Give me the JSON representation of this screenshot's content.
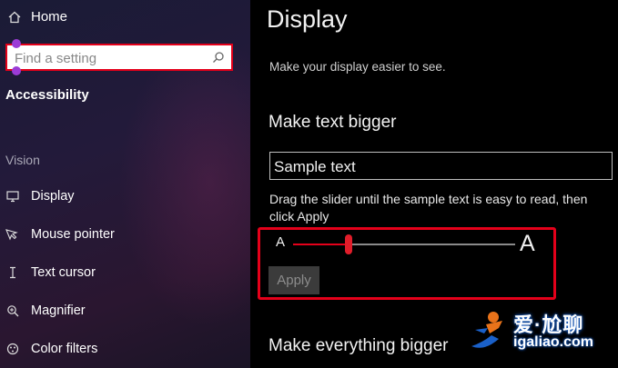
{
  "sidebar": {
    "home_label": "Home",
    "search_placeholder": "Find a setting",
    "section_title": "Accessibility",
    "group_label": "Vision",
    "items": [
      {
        "label": "Display",
        "icon": "monitor-icon"
      },
      {
        "label": "Mouse pointer",
        "icon": "mouse-pointer-icon"
      },
      {
        "label": "Text cursor",
        "icon": "text-cursor-icon"
      },
      {
        "label": "Magnifier",
        "icon": "magnifier-icon"
      },
      {
        "label": "Color filters",
        "icon": "color-filters-icon"
      }
    ]
  },
  "main": {
    "title": "Display",
    "subtitle": "Make your display easier to see.",
    "section_text_bigger": "Make text bigger",
    "sample_text": "Sample text",
    "instructions": "Drag the slider until the sample text is easy to read, then click Apply",
    "slider": {
      "min_label": "A",
      "max_label": "A",
      "value_fraction": 0.25
    },
    "apply_label": "Apply",
    "section_everything_bigger": "Make everything bigger"
  },
  "watermark": {
    "line1": "爱·尬聊",
    "line2": "igaliao.com"
  },
  "colors": {
    "highlight": "#e4001a",
    "slider_thumb": "#e11d2a",
    "accent_dot": "#9b3bd6"
  }
}
